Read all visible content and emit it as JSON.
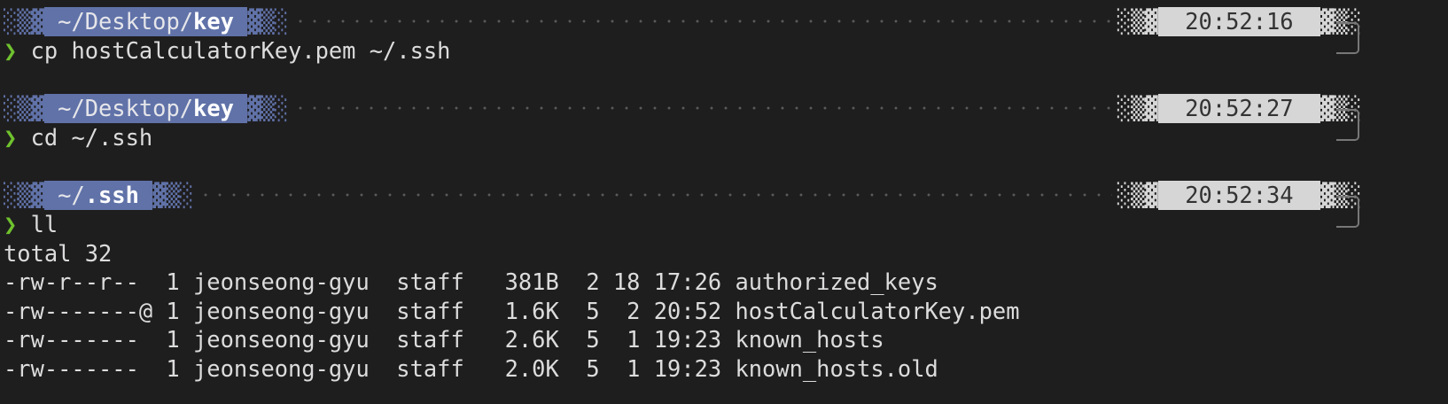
{
  "blocks": [
    {
      "path_prefix": "~/Desktop/",
      "path_dir": "key",
      "time": "20:52:16",
      "command": "cp hostCalculatorKey.pem ~/.ssh"
    },
    {
      "path_prefix": "~/Desktop/",
      "path_dir": "key",
      "time": "20:52:27",
      "command": "cd ~/.ssh"
    },
    {
      "path_prefix": "~/",
      "path_dir": ".ssh",
      "time": "20:52:34",
      "command": "ll"
    }
  ],
  "prompt_symbol": "❯",
  "output": [
    "total 32",
    "-rw-r--r--  1 jeonseong-gyu  staff   381B  2 18 17:26 authorized_keys",
    "-rw-------@ 1 jeonseong-gyu  staff   1.6K  5  2 20:52 hostCalculatorKey.pem",
    "-rw-------  1 jeonseong-gyu  staff   2.6K  5  1 19:23 known_hosts",
    "-rw-------  1 jeonseong-gyu  staff   2.0K  5  1 19:23 known_hosts.old"
  ],
  "colors": {
    "background": "#1f1e1f",
    "path_segment": "#6072a8",
    "time_segment": "#d6d6d6",
    "prompt": "#6fc22e"
  }
}
